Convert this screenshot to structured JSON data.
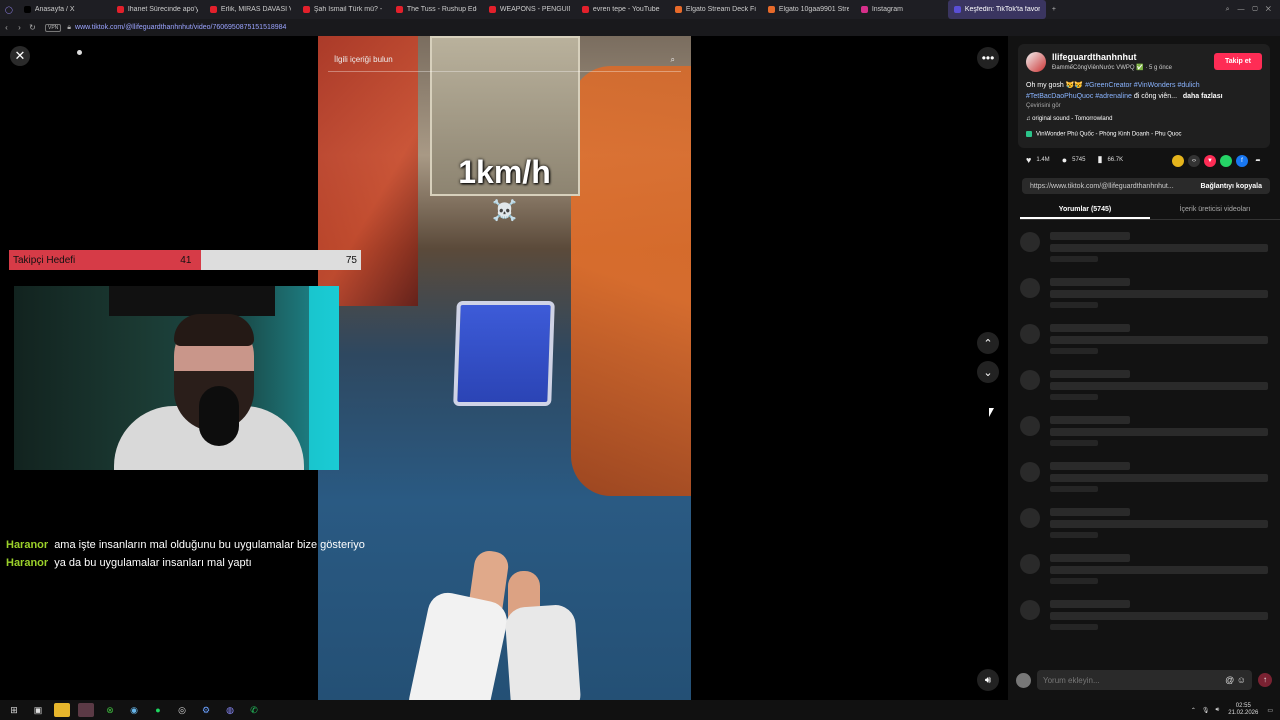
{
  "browser": {
    "tabs": [
      {
        "label": "Anasayfa / X",
        "color": "#000000",
        "active": false
      },
      {
        "label": "İhanet Sürecinde apo'ya t",
        "color": "#e3202b",
        "active": false
      },
      {
        "label": "Erlik, MİRAS DAVASI Vide",
        "color": "#e3202b",
        "active": false
      },
      {
        "label": "Şah İsmail Türk mü? - You",
        "color": "#e3202b",
        "active": false
      },
      {
        "label": "The Tuss - Rushup Edge",
        "color": "#e3202b",
        "active": false
      },
      {
        "label": "WEAPONS - PENGUIN - ",
        "color": "#e3202b",
        "active": false
      },
      {
        "label": "evren tepe - YouTube",
        "color": "#e3202b",
        "active": false
      },
      {
        "label": "Elgato Stream Deck Fiyatı",
        "color": "#e76a2a",
        "active": false
      },
      {
        "label": "Elgato 10gaa9901 Stream ",
        "color": "#e76a2a",
        "active": false
      },
      {
        "label": "Instagram",
        "color": "#d62f8a",
        "active": false
      },
      {
        "label": "Keşfedin: TikTok'ta favori",
        "color": "#5a4fd6",
        "active": true
      }
    ],
    "vpn_label": "VPN",
    "url": "www.tiktok.com/@llifeguardthanhnhut/video/7606950875151518984"
  },
  "video": {
    "search_placeholder": "İlgili içeriği bulun",
    "overlay_text": "1km/h",
    "overlay_emoji": "☠️"
  },
  "stream": {
    "goal_label": "Takipçi Hedefi",
    "goal_current": 41,
    "goal_target": 75,
    "chat": [
      {
        "user": "Haranor",
        "message": "ama işte insanların mal olduğunu bu uygulamalar bize gösteriyo"
      },
      {
        "user": "Haranor",
        "message": "ya da bu uygulamalar insanları mal yaptı"
      }
    ]
  },
  "panel": {
    "username": "llifeguardthanhnhut",
    "subline": "ĐammếCôngViênNước VWPQ ✅ · 5 g önce",
    "follow_label": "Takip et",
    "caption_text": "Oh my gosh 😿😿 ",
    "hashtags": [
      "#GreenCreator",
      "#VinWonders",
      "#dulich",
      "#TetBacDaoPhuQuoc",
      "#adrenaline"
    ],
    "caption_tail": " đi công viên...",
    "more_label": "daha fazlası",
    "translate_label": "Çevirisini gör",
    "sound": "original sound - Tomorrowland",
    "place": "VinWonder Phú Quốc - Phòng Kinh Doanh - Phu Quoc",
    "likes": "1.4M",
    "comments": "5745",
    "saves": "66.7K",
    "link_url": "https://www.tiktok.com/@llifeguardthanhnhut...",
    "copy_label": "Bağlantıyı kopyala",
    "tab_comments": "Yorumlar (5745)",
    "tab_creator": "İçerik üreticisi videoları",
    "comment_placeholder": "Yorum ekleyin...",
    "at_symbol": "@",
    "emoji_symbol": "☺"
  },
  "taskbar": {
    "time": "02:55",
    "date": "21.02.2026"
  }
}
